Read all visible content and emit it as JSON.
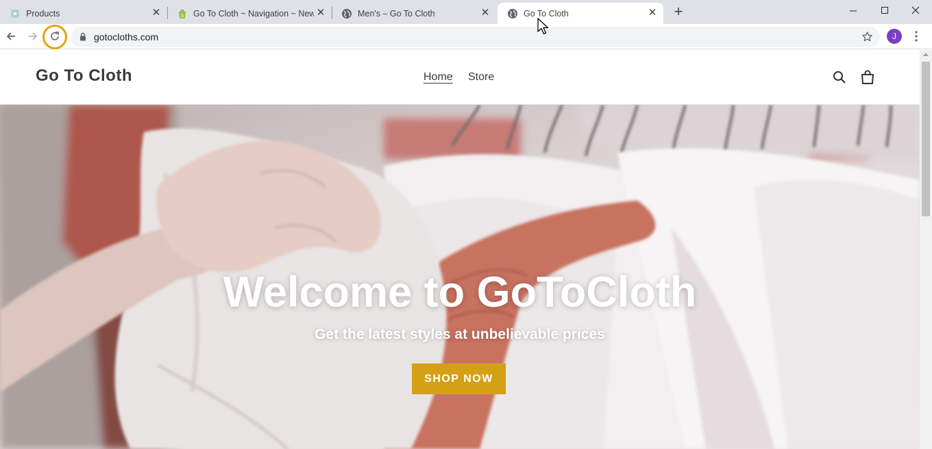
{
  "browser": {
    "tabs": [
      {
        "title": "Products",
        "favicon": "shopify-admin-icon",
        "active": false
      },
      {
        "title": "Go To Cloth ~ Navigation ~ New",
        "favicon": "shopify-bag-icon",
        "active": false
      },
      {
        "title": "Men's – Go To Cloth",
        "favicon": "globe-icon",
        "active": false
      },
      {
        "title": "Go To Cloth",
        "favicon": "globe-icon",
        "active": true
      }
    ],
    "close_glyph": "✕",
    "new_tab_glyph": "+",
    "url": "gotocloths.com",
    "profile_initial": "J",
    "highlight_color": "#e2a400"
  },
  "site": {
    "logo": "Go To Cloth",
    "nav": {
      "home": "Home",
      "store": "Store"
    },
    "hero": {
      "title": "Welcome to GoToCloth",
      "subtitle": "Get the latest styles at unbelievable prices",
      "button": "SHOP NOW",
      "button_color": "#d4a015"
    }
  }
}
